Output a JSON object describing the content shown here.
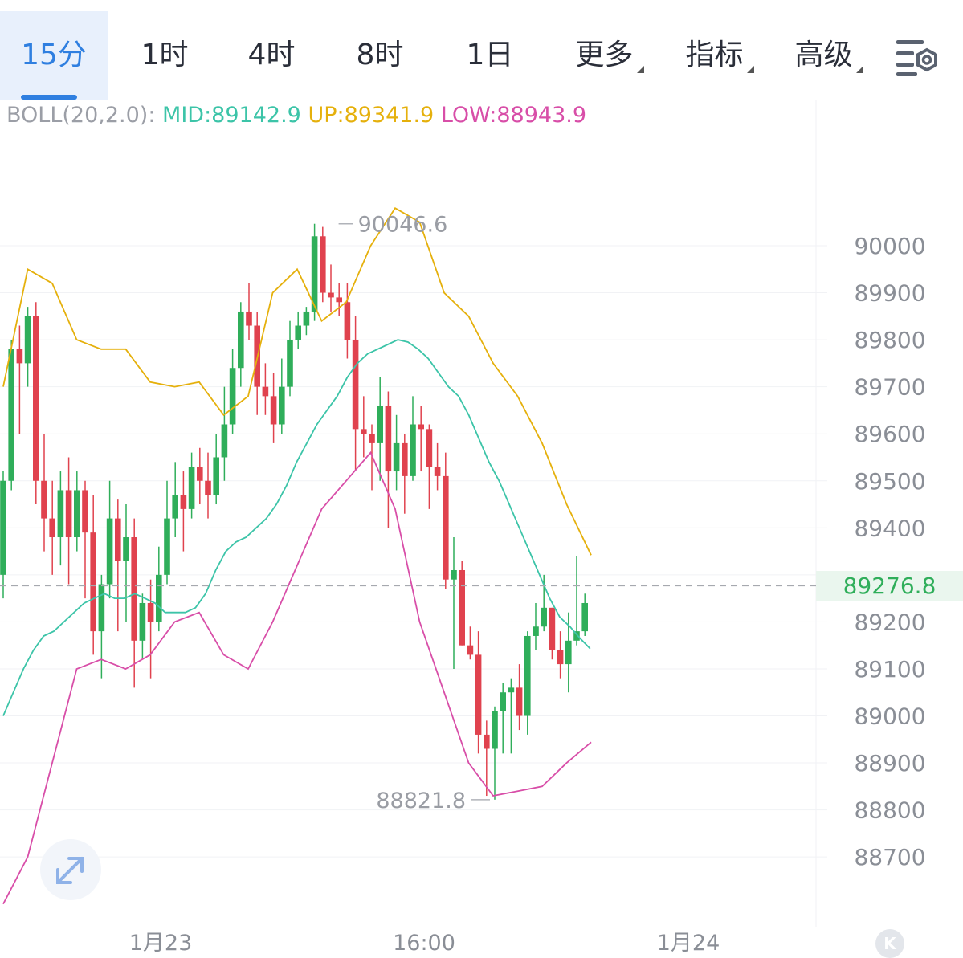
{
  "tabs": [
    {
      "label": "15分",
      "active": true
    },
    {
      "label": "1时"
    },
    {
      "label": "4时"
    },
    {
      "label": "8时"
    },
    {
      "label": "1日"
    },
    {
      "label": "更多",
      "dropdown": true
    },
    {
      "label": "指标",
      "dropdown": true
    },
    {
      "label": "高级",
      "dropdown": true
    }
  ],
  "toolbar": {
    "settings_icon": "chart-settings-icon"
  },
  "indicator": {
    "name": "BOLL(20,2.0):",
    "mid": "MID:89142.9",
    "up": "UP:89341.9",
    "low": "LOW:88943.9"
  },
  "current_price": "89276.8",
  "expand_icon": "expand-arrows-icon",
  "k_icon": "K",
  "colors": {
    "accent": "#2f7fe0",
    "up_candle": "#2fae5a",
    "down_candle": "#e0424e",
    "mid": "#3cc4a8",
    "upper": "#e5b00c",
    "lower": "#d84ea8"
  },
  "chart_data": {
    "type": "candlestick",
    "y_axis": {
      "ticks": [
        "90000",
        "89900",
        "89800",
        "89700",
        "89600",
        "89500",
        "89400",
        "89300",
        "89200",
        "89100",
        "89000",
        "88900",
        "88800",
        "88700"
      ],
      "min": 88600,
      "max": 90250
    },
    "x_axis": {
      "labels": [
        "1月23",
        "16:00",
        "1月24"
      ]
    },
    "annotations": {
      "high": "90046.6",
      "low": "88821.8"
    },
    "candles": [
      [
        89300,
        89500,
        89250,
        89520
      ],
      [
        89500,
        89780,
        89480,
        89800
      ],
      [
        89780,
        89750,
        89600,
        89830
      ],
      [
        89750,
        89850,
        89700,
        89870
      ],
      [
        89850,
        89500,
        89450,
        89880
      ],
      [
        89500,
        89420,
        89350,
        89600
      ],
      [
        89420,
        89380,
        89300,
        89500
      ],
      [
        89380,
        89480,
        89320,
        89520
      ],
      [
        89480,
        89380,
        89280,
        89550
      ],
      [
        89380,
        89480,
        89350,
        89520
      ],
      [
        89480,
        89390,
        89250,
        89500
      ],
      [
        89390,
        89180,
        89130,
        89470
      ],
      [
        89180,
        89280,
        89080,
        89300
      ],
      [
        89280,
        89420,
        89250,
        89500
      ],
      [
        89420,
        89330,
        89180,
        89460
      ],
      [
        89330,
        89380,
        89200,
        89450
      ],
      [
        89380,
        89160,
        89060,
        89420
      ],
      [
        89160,
        89240,
        89120,
        89260
      ],
      [
        89240,
        89200,
        89080,
        89290
      ],
      [
        89200,
        89300,
        89180,
        89360
      ],
      [
        89300,
        89420,
        89280,
        89500
      ],
      [
        89420,
        89470,
        89380,
        89540
      ],
      [
        89470,
        89440,
        89350,
        89520
      ],
      [
        89440,
        89530,
        89420,
        89560
      ],
      [
        89530,
        89500,
        89450,
        89570
      ],
      [
        89500,
        89470,
        89420,
        89560
      ],
      [
        89470,
        89550,
        89450,
        89600
      ],
      [
        89550,
        89620,
        89500,
        89700
      ],
      [
        89620,
        89740,
        89600,
        89780
      ],
      [
        89740,
        89860,
        89700,
        89880
      ],
      [
        89860,
        89830,
        89800,
        89920
      ],
      [
        89830,
        89700,
        89640,
        89860
      ],
      [
        89700,
        89680,
        89640,
        89750
      ],
      [
        89680,
        89620,
        89580,
        89730
      ],
      [
        89620,
        89700,
        89600,
        89760
      ],
      [
        89700,
        89800,
        89680,
        89840
      ],
      [
        89800,
        89830,
        89780,
        89860
      ],
      [
        89830,
        89860,
        89810,
        89870
      ],
      [
        89860,
        90020,
        89840,
        90046.6
      ],
      [
        90020,
        89900,
        89880,
        90040
      ],
      [
        89900,
        89890,
        89860,
        89960
      ],
      [
        89890,
        89880,
        89850,
        89920
      ],
      [
        89880,
        89800,
        89760,
        89920
      ],
      [
        89800,
        89610,
        89520,
        89850
      ],
      [
        89610,
        89600,
        89550,
        89680
      ],
      [
        89600,
        89580,
        89480,
        89620
      ],
      [
        89580,
        89660,
        89500,
        89720
      ],
      [
        89660,
        89520,
        89400,
        89690
      ],
      [
        89520,
        89580,
        89480,
        89640
      ],
      [
        89580,
        89510,
        89430,
        89600
      ],
      [
        89510,
        89620,
        89500,
        89680
      ],
      [
        89620,
        89610,
        89520,
        89660
      ],
      [
        89610,
        89530,
        89440,
        89620
      ],
      [
        89530,
        89510,
        89480,
        89580
      ],
      [
        89510,
        89290,
        89270,
        89560
      ],
      [
        89290,
        89310,
        89100,
        89380
      ],
      [
        89310,
        89150,
        89150,
        89330
      ],
      [
        89150,
        89130,
        89120,
        89190
      ],
      [
        89130,
        88960,
        88920,
        89180
      ],
      [
        88960,
        88930,
        88830,
        88990
      ],
      [
        88930,
        89010,
        88821.8,
        89020
      ],
      [
        89010,
        89050,
        88920,
        89070
      ],
      [
        89050,
        89060,
        88920,
        89080
      ],
      [
        89060,
        89000,
        88970,
        89110
      ],
      [
        89000,
        89170,
        88960,
        89180
      ],
      [
        89170,
        89190,
        89140,
        89240
      ],
      [
        89190,
        89230,
        89180,
        89300
      ],
      [
        89230,
        89140,
        89120,
        89230
      ],
      [
        89140,
        89110,
        89080,
        89180
      ],
      [
        89110,
        89160,
        89050,
        89220
      ],
      [
        89160,
        89180,
        89150,
        89340
      ],
      [
        89180,
        89240,
        89170,
        89260
      ]
    ],
    "mid": [
      89000,
      89050,
      89100,
      89140,
      89170,
      89180,
      89200,
      89220,
      89240,
      89250,
      89260,
      89250,
      89250,
      89260,
      89250,
      89240,
      89220,
      89220,
      89220,
      89230,
      89260,
      89310,
      89350,
      89370,
      89380,
      89400,
      89420,
      89450,
      89490,
      89540,
      89580,
      89620,
      89650,
      89680,
      89720,
      89750,
      89770,
      89780,
      89790,
      89800,
      89795,
      89780,
      89760,
      89730,
      89700,
      89680,
      89640,
      89590,
      89540,
      89500,
      89450,
      89400,
      89350,
      89300,
      89250,
      89210,
      89190,
      89165,
      89142.9
    ],
    "upper": [
      89700,
      89950,
      89920,
      89800,
      89780,
      89780,
      89710,
      89700,
      89710,
      89640,
      89680,
      89900,
      89950,
      89840,
      89880,
      90000,
      90080,
      90050,
      89900,
      89850,
      89750,
      89680,
      89580,
      89450,
      89341.9
    ],
    "lower": [
      88600,
      88700,
      88900,
      89100,
      89120,
      89100,
      89130,
      89200,
      89220,
      89130,
      89100,
      89200,
      89320,
      89440,
      89500,
      89560,
      89440,
      89200,
      89050,
      88900,
      88830,
      88840,
      88850,
      88900,
      88943.9
    ]
  }
}
